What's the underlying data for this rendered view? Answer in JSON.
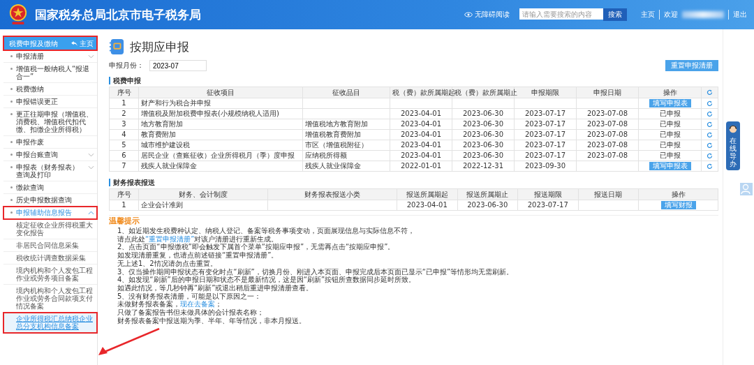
{
  "header": {
    "title": "国家税务总局北京市电子税务局",
    "accessibility": "无障碍阅读",
    "search": {
      "placeholder": "请输入需要搜索的内容",
      "button": "搜索"
    },
    "links": [
      "主页",
      "欢迎",
      "退出"
    ]
  },
  "sidebar": {
    "title": "税费申报及缴纳",
    "home": "主页",
    "annotated": true,
    "items": [
      {
        "label": "申报清册",
        "expanded": false,
        "selected": false,
        "annotated": false
      },
      {
        "label": "增值税一般纳税人“报退合一”",
        "selected": false,
        "annotated": false
      },
      {
        "label": "税费缴纳",
        "selected": false,
        "annotated": false
      },
      {
        "label": "申报错误更正",
        "selected": false,
        "annotated": false
      },
      {
        "label": "更正往期申报（增值税、消费税、增值税代扣代缴、扣缴企业所得税）",
        "selected": false,
        "annotated": false
      },
      {
        "label": "申报作废",
        "selected": false,
        "annotated": false
      },
      {
        "label": "申报台账查询",
        "expanded": false,
        "selected": false,
        "annotated": false
      },
      {
        "label": "申报表（财务报表）查询及打印",
        "expanded": false,
        "selected": false,
        "annotated": false
      },
      {
        "label": "缴款查询",
        "selected": false,
        "annotated": false
      },
      {
        "label": "历史申报数据查询",
        "selected": false,
        "annotated": false
      },
      {
        "label": "申报辅助信息报告",
        "expanded": true,
        "selected": true,
        "annotated": true,
        "children": [
          {
            "label": "核定征收企业所得税重大变化报告",
            "selected": false,
            "annotated": false
          },
          {
            "label": "非居民合同信息采集",
            "selected": false,
            "annotated": false
          },
          {
            "label": "税收统计调查数据采集",
            "selected": false,
            "annotated": false
          },
          {
            "label": "境内机构和个人发包工程作业或劳务项目备案",
            "selected": false,
            "annotated": false
          },
          {
            "label": "境内机构和个人发包工程作业或劳务合同款项支付情况备案",
            "selected": false,
            "annotated": false
          },
          {
            "label": "企业所得税汇总纳税企业总分支机构信息备案",
            "selected": true,
            "annotated": true
          }
        ]
      }
    ]
  },
  "page": {
    "title": "按期应申报",
    "month_label": "申报月份：",
    "month": "2023-07",
    "reset_button": "重置申报清册"
  },
  "tax_section": {
    "title": "税费申报",
    "columns": [
      "序号",
      "征收项目",
      "征收品目",
      "税（费）款所属期起",
      "税（费）款所属期止",
      "申报期限",
      "申报日期",
      "操作"
    ],
    "rows": [
      {
        "cells": [
          "1",
          "财产和行为税合并申报",
          "",
          "",
          "",
          "",
          ""
        ],
        "action": {
          "kind": "button",
          "text": "填写申报表"
        }
      },
      {
        "cells": [
          "2",
          "增值税及附加税费申报表(小规模纳税人适用)",
          "",
          "2023-04-01",
          "2023-06-30",
          "2023-07-17",
          "2023-07-08"
        ],
        "action": {
          "kind": "status",
          "text": "已申报"
        }
      },
      {
        "cells": [
          "3",
          "地方教育附加",
          "增值税地方教育附加",
          "2023-04-01",
          "2023-06-30",
          "2023-07-17",
          "2023-07-08"
        ],
        "action": {
          "kind": "status",
          "text": "已申报"
        }
      },
      {
        "cells": [
          "4",
          "教育费附加",
          "增值税教育费附加",
          "2023-04-01",
          "2023-06-30",
          "2023-07-17",
          "2023-07-08"
        ],
        "action": {
          "kind": "status",
          "text": "已申报"
        }
      },
      {
        "cells": [
          "5",
          "城市维护建设税",
          "市区（增值税附征）",
          "2023-04-01",
          "2023-06-30",
          "2023-07-17",
          "2023-07-08"
        ],
        "action": {
          "kind": "status",
          "text": "已申报"
        }
      },
      {
        "cells": [
          "6",
          "居民企业（查账征收）企业所得税月（季）度申报",
          "应纳税所得额",
          "2023-04-01",
          "2023-06-30",
          "2023-07-17",
          "2023-07-08"
        ],
        "action": {
          "kind": "status",
          "text": "已申报"
        }
      },
      {
        "cells": [
          "7",
          "残疾人就业保障金",
          "残疾人就业保障金",
          "2022-01-01",
          "2022-12-31",
          "2023-09-30",
          ""
        ],
        "action": {
          "kind": "button",
          "text": "填写申报表"
        }
      }
    ]
  },
  "finance_section": {
    "title": "财务报表报送",
    "columns": [
      "序号",
      "财务、会计制度",
      "财务报表报送小类",
      "报送所属期起",
      "报送所属期止",
      "报送期限",
      "报送日期",
      "操作"
    ],
    "rows": [
      {
        "cells": [
          "1",
          "企业会计准则",
          "",
          "2023-04-01",
          "2023-06-30",
          "2023-07-17",
          ""
        ],
        "action": {
          "kind": "button",
          "text": "填写财报"
        }
      }
    ]
  },
  "tips": {
    "title": "温馨提示",
    "lines": [
      [
        {
          "text": "1、如近期发生税费种认定、纳税人登记、备案等税务事项变动，页面展现信息与实际信息不符，"
        }
      ],
      [
        {
          "text": "请点此处"
        },
        {
          "text": "“重置申报清册”",
          "link": true
        },
        {
          "text": "对该户清册进行重新生成。"
        }
      ],
      [
        {
          "text": "2、点击页面“申报缴税”即会触发下属首个菜单“按期应申报”，无需再点击“按期应申报”。"
        }
      ],
      [
        {
          "text": "如发现清册重复，也请点前述链接“重置申报清册”。"
        }
      ],
      [
        {
          "text": "无上述1、2情况请勿点击重置。"
        }
      ],
      [
        {
          "text": "3、仅当操作期间申报状态有变化时点“刷新”，切换月份、刚进入本页面、申报完成后本页面已显示“已申报”等情形均无需刷新。"
        }
      ],
      [
        {
          "text": "4、如发现“刷新”后的申报日期和状态不是最新情况，这是因“刷新”按钮所查数据同步延时所致。"
        }
      ],
      [
        {
          "text": "如遇此情况，等几秒钟再“刷新”或退出稍后重进申报清册查看。"
        }
      ],
      [
        {
          "text": "5、没有财务报表清册，可能是以下原因之一："
        }
      ],
      [
        {
          "text": "未做财务报表备案，"
        },
        {
          "text": "现在去备案",
          "link": true
        },
        {
          "text": "；"
        }
      ],
      [
        {
          "text": "只做了备案报告书但未做具体的会计报表名称；"
        }
      ],
      [
        {
          "text": "财务报表备案中报送期为季、半年、年等情况，非本月报送。"
        }
      ]
    ]
  },
  "float_help": {
    "label": "在线导办"
  }
}
